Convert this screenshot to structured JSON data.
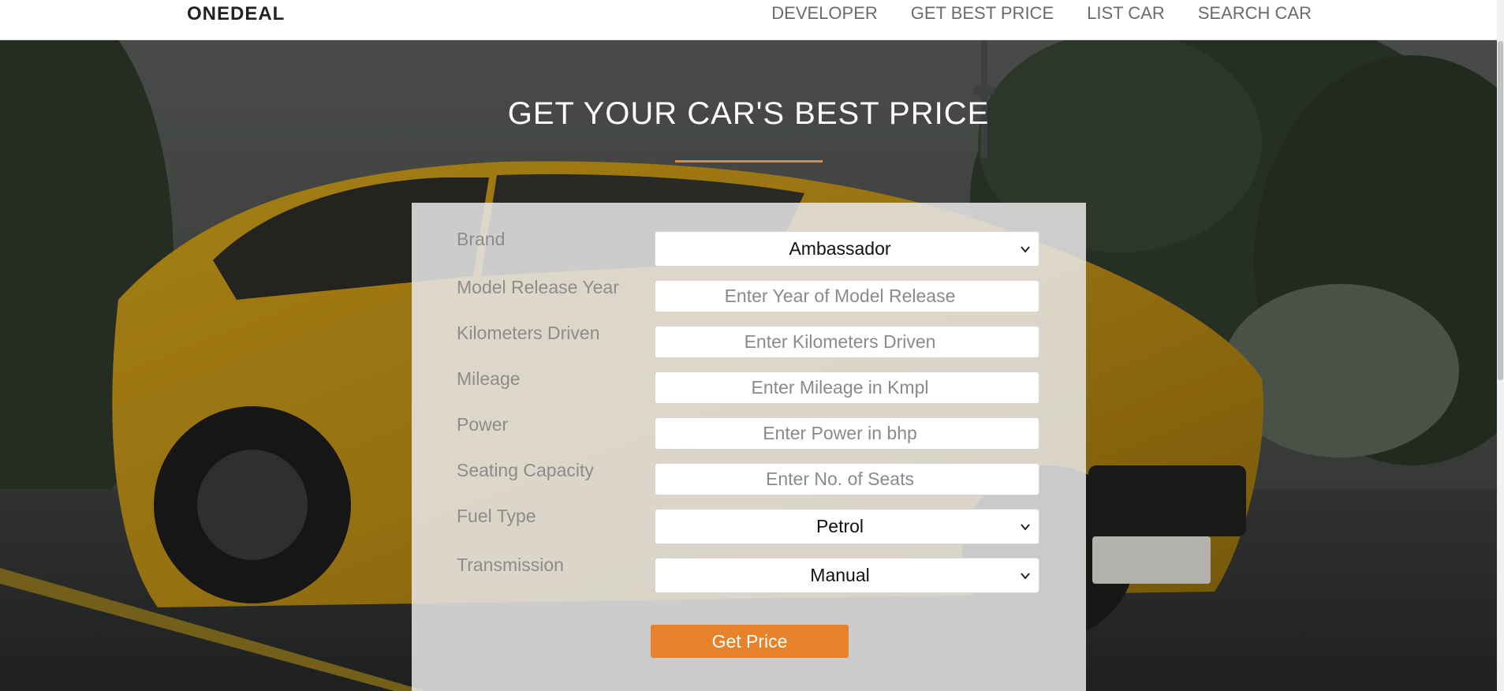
{
  "navbar": {
    "brand": "ONEDEAL",
    "links": [
      {
        "label": "DEVELOPER"
      },
      {
        "label": "GET BEST PRICE"
      },
      {
        "label": "LIST CAR"
      },
      {
        "label": "SEARCH CAR"
      }
    ]
  },
  "hero": {
    "heading": "GET YOUR CAR'S BEST PRICE",
    "accent_color": "#e98a2e"
  },
  "form": {
    "brand": {
      "label": "Brand",
      "selected": "Ambassador"
    },
    "model_year": {
      "label": "Model Release Year",
      "placeholder": "Enter Year of Model Release"
    },
    "kilometers": {
      "label": "Kilometers Driven",
      "placeholder": "Enter Kilometers Driven"
    },
    "mileage": {
      "label": "Mileage",
      "placeholder": "Enter Mileage in Kmpl"
    },
    "power": {
      "label": "Power",
      "placeholder": "Enter Power in bhp"
    },
    "seats": {
      "label": "Seating Capacity",
      "placeholder": "Enter No. of Seats"
    },
    "fuel": {
      "label": "Fuel Type",
      "selected": "Petrol"
    },
    "transmission": {
      "label": "Transmission",
      "selected": "Manual"
    },
    "submit_label": "Get Price",
    "button_color": "#e8822a"
  },
  "icons": {
    "dropdown": "chevron-down-icon"
  }
}
